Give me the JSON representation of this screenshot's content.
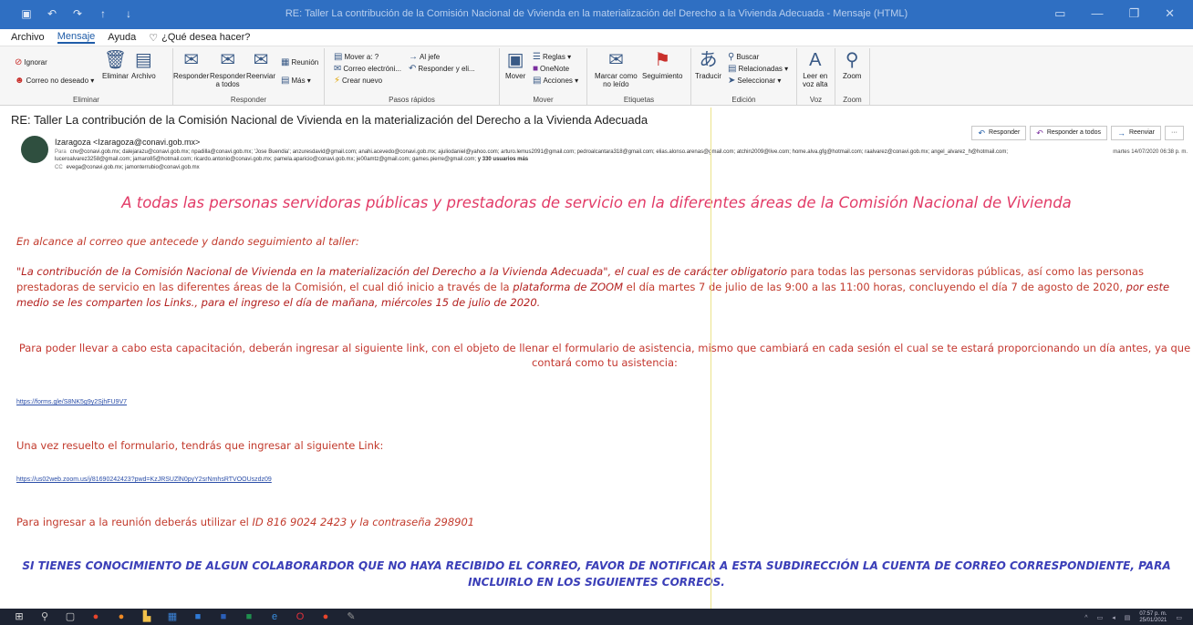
{
  "window": {
    "title": "RE: Taller La contribución de la Comisión Nacional de Vivienda en la materialización del Derecho a la Vivienda Adecuada - Mensaje (HTML)",
    "quick_access": [
      "save-icon",
      "undo-icon",
      "redo-icon",
      "up-icon",
      "down-icon"
    ],
    "controls": [
      "ribbon-options-icon",
      "minimize-icon",
      "restore-icon",
      "close-icon"
    ]
  },
  "menu": {
    "tabs": [
      "Archivo",
      "Mensaje",
      "Ayuda"
    ],
    "active_tab": "Mensaje",
    "tell_me": "¿Qué desea hacer?"
  },
  "ribbon": {
    "eliminar": {
      "name": "Eliminar",
      "ignorar": "Ignorar",
      "correo_no_deseado": "Correo no deseado",
      "eliminar": "Eliminar",
      "archivo": "Archivo"
    },
    "responder": {
      "name": "Responder",
      "responder": "Responder",
      "responder_todos_1": "Responder",
      "responder_todos_2": "a todos",
      "reenviar": "Reenviar",
      "reunion": "Reunión",
      "mas": "Más"
    },
    "pasos": {
      "name": "Pasos rápidos",
      "mover_a": "Mover a: ?",
      "al_jefe": "Al jefe",
      "correo_electronico": "Correo electróni...",
      "responder_eli": "Responder y eli...",
      "crear_nuevo": "Crear nuevo"
    },
    "mover": {
      "name": "Mover",
      "mover": "Mover",
      "reglas": "Reglas",
      "onenote": "OneNote",
      "acciones": "Acciones"
    },
    "etiquetas": {
      "name": "Etiquetas",
      "marcar_1": "Marcar como",
      "marcar_2": "no leído",
      "seguimiento": "Seguimiento"
    },
    "edicion": {
      "name": "Edición",
      "traducir": "Traducir",
      "buscar": "Buscar",
      "relacionadas": "Relacionadas",
      "seleccionar": "Seleccionar"
    },
    "voz": {
      "name": "Voz",
      "leer_1": "Leer en",
      "leer_2": "voz alta"
    },
    "zoom": {
      "name": "Zoom",
      "zoom": "Zoom"
    }
  },
  "message": {
    "subject": "RE: Taller La contribución de la Comisión Nacional de Vivienda en la materialización del Derecho a la Vivienda Adecuada",
    "from": "Izaragoza <Izaragoza@conavi.gob.mx>",
    "to_label": "Para",
    "to": "cnv@conavi.gob.mx; dalejarazu@conavi.gob.mx; npadilla@conavi.gob.mx; 'Jose Buendia'; anzuresdavid@gmail.com; anahi.acevedo@conavi.gob.mx; ajuliodaniel@yahoo.com; arturo.lemus2091@gmail.com; pedroalcantara318@gmail.com; elias.alonso.arenas@gmail.com; atchin2009@live.com; home.alva.gfg@hotmail.com; raalvarez@conavi.gob.mx; angel_alvarez_h@hotmail.com; luceroalvarez3258@gmail.com; jamaro85@hotmail.com; ricardo.antonio@conavi.gob.mx; pamela.aparicio@conavi.gob.mx; je00amtz@gmail.com; games.pierre@gmail.com;",
    "to_more": "y 330 usuarios más",
    "cc_label": "CC",
    "cc": "evega@conavi.gob.mx; jamonterrubio@conavi.gob.mx",
    "date": "martes 14/07/2020 06:38 p. m.",
    "actions": {
      "reply": "Responder",
      "reply_all": "Responder a todos",
      "forward": "Reenviar",
      "more": "···"
    }
  },
  "body": {
    "heading": "A todas las personas servidoras públicas y prestadoras de servicio en la diferentes áreas de la Comisión Nacional de Vivienda",
    "intro": "En alcance al correo que antecede y dando seguimiento al taller:",
    "p1_a": "\"La contribución de la Comisión Nacional de Vivienda en la materialización del Derecho a la Vivienda Adecuada\", el cual es de carácter obligatorio",
    "p1_b": " para todas las personas servidoras públicas, así como las personas prestadoras de servicio en las diferentes áreas de la Comisión, el cual dió inicio a través de la ",
    "p1_c": "plataforma de ZOOM",
    "p1_d": " el día martes 7 de julio de las 9:00 a las 11:00 horas, concluyendo el día 7 de agosto de 2020, ",
    "p1_e": "por este medio se les comparten los Links., para el ingreso el día de mañana, miércoles 15 de julio de 2020.",
    "p2": "Para poder llevar a cabo esta capacitación, deberán ingresar al siguiente link, con el objeto de llenar el formulario de asistencia, mismo que cambiará en cada sesión el cual se te estará proporcionando un día antes, ya que contará como tu asistencia:",
    "link1": "https://forms.gle/S8NK5g9y2SjhFU9V7",
    "p3": "Una vez resuelto el formulario, tendrás que ingresar al siguiente Link:",
    "link2": "https://us02web.zoom.us/j/81690242423?pwd=KzJRSUZlN0pyY2srNmhsRTVOOUszdz09",
    "p4_a": "Para ingresar a la reunión deberás utilizar el ",
    "p4_b": "ID 816 9024 2423 y la contraseña 298901",
    "bottom": "SI TIENES CONOCIMIENTO DE ALGUN COLABORARDOR QUE NO HAYA RECIBIDO EL CORREO, FAVOR DE NOTIFICAR A ESTA SUBDIRECCIÓN LA CUENTA DE CORREO CORRESPONDIENTE, PARA INCLUIRLO EN LOS SIGUIENTES CORREOS."
  },
  "taskbar": {
    "icons": [
      "start-icon",
      "search-icon",
      "task-view-icon",
      "chrome-icon",
      "firefox-icon",
      "files-icon",
      "calendar-icon",
      "outlook-icon",
      "word-icon",
      "excel-icon",
      "edge-icon",
      "opera-icon",
      "chrome-alt-icon",
      "paint-icon"
    ],
    "time": "07:57 p. m.",
    "date": "25/01/2021"
  },
  "colors": {
    "title_bar": "#2f6fc2",
    "heading": "#e23b67",
    "body_text": "#c23a2c",
    "link": "#2b4ea8",
    "bottom_note": "#3b3fb8"
  }
}
